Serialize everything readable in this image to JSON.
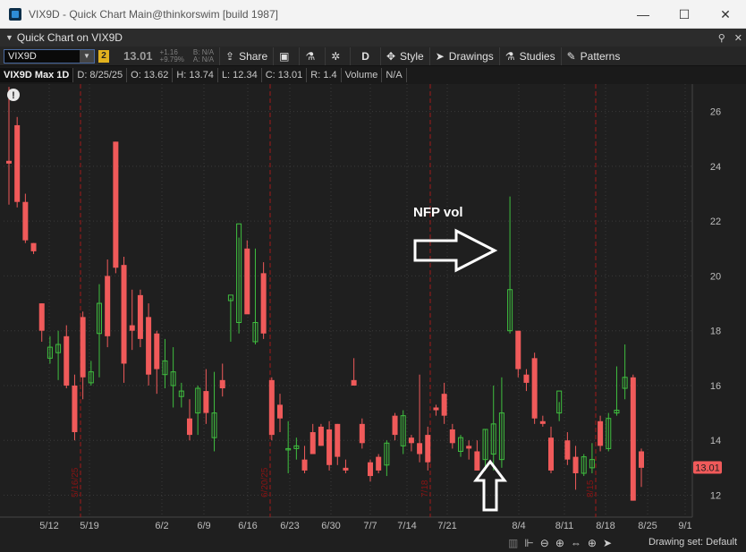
{
  "window": {
    "title": "VIX9D - Quick Chart Main@thinkorswim [build 1987]",
    "minimize": "—",
    "maximize": "☐",
    "close": "✕"
  },
  "panel": {
    "title": "Quick Chart on VIX9D",
    "pin": "📌",
    "close": "✕"
  },
  "toolbar": {
    "symbol": "VIX9D",
    "link_badge": "2",
    "last_price": "13.01",
    "change_abs": "+1.16",
    "change_pct": "+9.79%",
    "bid": "B: N/A",
    "ask": "A: N/A",
    "share_label": "Share",
    "aggregation": "D",
    "style_label": "Style",
    "drawings_label": "Drawings",
    "studies_label": "Studies",
    "patterns_label": "Patterns"
  },
  "infobar": {
    "chart_title": "VIX9D Max 1D",
    "date": "D: 8/25/25",
    "open": "O: 13.62",
    "high": "H: 13.74",
    "low": "L: 12.34",
    "close": "C: 13.01",
    "range": "R: 1.4",
    "volume_label": "Volume",
    "volume_value": "N/A"
  },
  "chart_data": {
    "type": "candlestick",
    "y_axis_labels": [
      "26",
      "24",
      "22",
      "20",
      "18",
      "16",
      "14",
      "12"
    ],
    "x_axis_labels": [
      "5/12",
      "5/19",
      "6/2",
      "6/9",
      "6/16",
      "6/23",
      "6/30",
      "7/7",
      "7/14",
      "7/21",
      "8/4",
      "8/11",
      "8/18",
      "8/25",
      "9/1"
    ],
    "ylim": [
      11.2,
      27.0
    ],
    "last_price_label": "13.01",
    "event_markers": [
      "5/16/25",
      "6/20/25",
      "7/18",
      "8/15"
    ],
    "annotation_text": "NFP vol",
    "info_icon": "!",
    "colors": {
      "up": "#3fbf3f",
      "down": "#f05a5a",
      "background": "#1f1f1f",
      "grid": "#3a3a3a",
      "marker": "#a01818"
    },
    "candles": [
      {
        "o": 24.2,
        "h": 26.9,
        "l": 22.6,
        "c": 24.1
      },
      {
        "o": 25.5,
        "h": 25.8,
        "l": 22.5,
        "c": 22.7
      },
      {
        "o": 22.7,
        "h": 23.0,
        "l": 21.2,
        "c": 21.3
      },
      {
        "o": 21.2,
        "h": 21.2,
        "l": 20.8,
        "c": 20.9
      },
      {
        "o": 19.0,
        "h": 19.0,
        "l": 17.6,
        "c": 18.0
      },
      {
        "o": 17.0,
        "h": 17.8,
        "l": 16.8,
        "c": 17.4
      },
      {
        "o": 17.2,
        "h": 18.0,
        "l": 16.2,
        "c": 17.5
      },
      {
        "o": 17.8,
        "h": 18.2,
        "l": 15.9,
        "c": 16.0
      },
      {
        "o": 16.0,
        "h": 16.4,
        "l": 14.0,
        "c": 14.3
      },
      {
        "o": 18.5,
        "h": 18.7,
        "l": 15.5,
        "c": 16.3
      },
      {
        "o": 16.1,
        "h": 16.9,
        "l": 16.0,
        "c": 16.5
      },
      {
        "o": 17.9,
        "h": 19.7,
        "l": 16.3,
        "c": 19.0
      },
      {
        "o": 20.0,
        "h": 20.6,
        "l": 17.4,
        "c": 17.8
      },
      {
        "o": 24.9,
        "h": 24.9,
        "l": 20.1,
        "c": 20.3
      },
      {
        "o": 20.4,
        "h": 20.7,
        "l": 16.1,
        "c": 16.8
      },
      {
        "o": 18.2,
        "h": 19.5,
        "l": 17.3,
        "c": 18.0
      },
      {
        "o": 19.3,
        "h": 19.5,
        "l": 17.4,
        "c": 17.7
      },
      {
        "o": 18.5,
        "h": 19.0,
        "l": 16.0,
        "c": 16.4
      },
      {
        "o": 17.9,
        "h": 18.0,
        "l": 15.7,
        "c": 16.6
      },
      {
        "o": 16.4,
        "h": 17.7,
        "l": 15.9,
        "c": 16.9
      },
      {
        "o": 16.0,
        "h": 17.4,
        "l": 15.2,
        "c": 16.5
      },
      {
        "o": 15.6,
        "h": 16.1,
        "l": 15.2,
        "c": 15.8
      },
      {
        "o": 14.8,
        "h": 15.5,
        "l": 14.0,
        "c": 14.2
      },
      {
        "o": 15.0,
        "h": 16.0,
        "l": 14.2,
        "c": 15.9
      },
      {
        "o": 15.8,
        "h": 16.6,
        "l": 14.6,
        "c": 15.0
      },
      {
        "o": 14.1,
        "h": 16.5,
        "l": 13.6,
        "c": 15.0
      },
      {
        "o": 16.2,
        "h": 16.8,
        "l": 15.6,
        "c": 15.9
      },
      {
        "o": 19.1,
        "h": 19.2,
        "l": 17.6,
        "c": 19.3
      },
      {
        "o": 18.3,
        "h": 21.4,
        "l": 17.9,
        "c": 21.9
      },
      {
        "o": 21.0,
        "h": 21.3,
        "l": 18.7,
        "c": 18.6
      },
      {
        "o": 17.6,
        "h": 21.0,
        "l": 17.5,
        "c": 18.3
      },
      {
        "o": 20.1,
        "h": 20.5,
        "l": 17.7,
        "c": 17.9
      },
      {
        "o": 16.2,
        "h": 16.3,
        "l": 14.0,
        "c": 14.2
      },
      {
        "o": 15.3,
        "h": 15.7,
        "l": 14.3,
        "c": 14.8
      },
      {
        "o": 13.7,
        "h": 14.7,
        "l": 12.8,
        "c": 13.7
      },
      {
        "o": 13.7,
        "h": 14.1,
        "l": 13.3,
        "c": 13.8
      },
      {
        "o": 13.3,
        "h": 13.8,
        "l": 12.8,
        "c": 12.9
      },
      {
        "o": 14.3,
        "h": 14.6,
        "l": 13.9,
        "c": 13.5
      },
      {
        "o": 14.5,
        "h": 14.6,
        "l": 13.8,
        "c": 13.8
      },
      {
        "o": 14.4,
        "h": 14.7,
        "l": 12.9,
        "c": 13.1
      },
      {
        "o": 14.6,
        "h": 14.6,
        "l": 13.1,
        "c": 13.4
      },
      {
        "o": 13.0,
        "h": 13.3,
        "l": 12.8,
        "c": 12.9
      },
      {
        "o": 16.2,
        "h": 17.0,
        "l": 16.0,
        "c": 16.0
      },
      {
        "o": 14.6,
        "h": 14.8,
        "l": 13.7,
        "c": 13.9
      },
      {
        "o": 13.2,
        "h": 13.3,
        "l": 12.5,
        "c": 12.7
      },
      {
        "o": 13.4,
        "h": 13.5,
        "l": 12.8,
        "c": 12.9
      },
      {
        "o": 13.1,
        "h": 14.0,
        "l": 12.7,
        "c": 13.9
      },
      {
        "o": 14.9,
        "h": 15.0,
        "l": 14.0,
        "c": 14.2
      },
      {
        "o": 13.8,
        "h": 15.1,
        "l": 13.5,
        "c": 14.9
      },
      {
        "o": 14.1,
        "h": 14.2,
        "l": 13.6,
        "c": 13.9
      },
      {
        "o": 13.9,
        "h": 16.4,
        "l": 13.2,
        "c": 13.5
      },
      {
        "o": 14.2,
        "h": 14.5,
        "l": 12.9,
        "c": 13.2
      },
      {
        "o": 15.2,
        "h": 15.3,
        "l": 14.9,
        "c": 15.1
      },
      {
        "o": 15.7,
        "h": 16.1,
        "l": 14.6,
        "c": 14.9
      },
      {
        "o": 14.4,
        "h": 14.6,
        "l": 13.7,
        "c": 13.9
      },
      {
        "o": 13.6,
        "h": 14.2,
        "l": 13.4,
        "c": 14.1
      },
      {
        "o": 13.8,
        "h": 14.0,
        "l": 13.3,
        "c": 13.7
      },
      {
        "o": 13.6,
        "h": 14.0,
        "l": 12.9,
        "c": 12.9
      },
      {
        "o": 13.3,
        "h": 14.4,
        "l": 12.9,
        "c": 14.4
      },
      {
        "o": 13.5,
        "h": 16.0,
        "l": 12.9,
        "c": 14.6
      },
      {
        "o": 13.3,
        "h": 16.3,
        "l": 13.0,
        "c": 15.0
      },
      {
        "o": 18.0,
        "h": 22.9,
        "l": 17.9,
        "c": 19.5
      },
      {
        "o": 18.0,
        "h": 18.0,
        "l": 16.3,
        "c": 16.6
      },
      {
        "o": 16.4,
        "h": 16.6,
        "l": 15.8,
        "c": 16.1
      },
      {
        "o": 17.0,
        "h": 17.2,
        "l": 14.6,
        "c": 14.8
      },
      {
        "o": 14.7,
        "h": 14.9,
        "l": 14.5,
        "c": 14.6
      },
      {
        "o": 14.1,
        "h": 14.5,
        "l": 12.8,
        "c": 12.9
      },
      {
        "o": 15.0,
        "h": 15.4,
        "l": 14.7,
        "c": 15.8
      },
      {
        "o": 14.0,
        "h": 14.3,
        "l": 13.1,
        "c": 13.3
      },
      {
        "o": 13.4,
        "h": 13.8,
        "l": 12.2,
        "c": 12.8
      },
      {
        "o": 12.8,
        "h": 13.5,
        "l": 12.7,
        "c": 13.4
      },
      {
        "o": 13.0,
        "h": 13.9,
        "l": 12.8,
        "c": 13.3
      },
      {
        "o": 14.7,
        "h": 14.9,
        "l": 13.6,
        "c": 13.8
      },
      {
        "o": 13.7,
        "h": 15.0,
        "l": 13.6,
        "c": 14.8
      },
      {
        "o": 15.0,
        "h": 16.7,
        "l": 14.9,
        "c": 15.1
      },
      {
        "o": 15.9,
        "h": 17.5,
        "l": 15.5,
        "c": 16.3
      },
      {
        "o": 16.3,
        "h": 16.4,
        "l": 11.8,
        "c": 11.8
      },
      {
        "o": 13.6,
        "h": 13.7,
        "l": 12.3,
        "c": 13.0
      }
    ]
  },
  "statusbar": {
    "drawing_set": "Drawing set: Default"
  }
}
